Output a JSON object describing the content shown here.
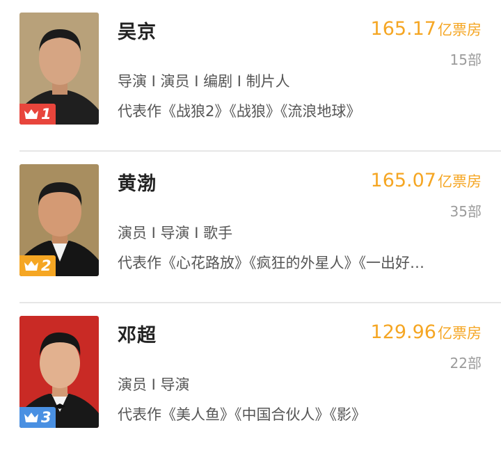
{
  "ranking": [
    {
      "rank": "1",
      "name": "吴京",
      "box_office": "165.17",
      "box_office_unit": "亿票房",
      "films_count": "15部",
      "roles": "导演 I 演员 I 编剧 I 制片人",
      "works": "代表作《战狼2》《战狼》《流浪地球》",
      "badge_color": "#e8453c",
      "badge_icon": "crown-icon",
      "photo_bg": "#b8a17a",
      "shirt_color": "#1f1f1f"
    },
    {
      "rank": "2",
      "name": "黄渤",
      "box_office": "165.07",
      "box_office_unit": "亿票房",
      "films_count": "35部",
      "roles": "演员 I 导演 I 歌手",
      "works": "代表作《心花路放》《疯狂的外星人》《一出好…",
      "badge_color": "#f5a623",
      "badge_icon": "crown-icon",
      "photo_bg": "#a88e60",
      "shirt_color": "#151515"
    },
    {
      "rank": "3",
      "name": "邓超",
      "box_office": "129.96",
      "box_office_unit": "亿票房",
      "films_count": "22部",
      "roles": "演员 I 导演",
      "works": "代表作《美人鱼》《中国合伙人》《影》",
      "badge_color": "#4a90e2",
      "badge_icon": "crown-icon",
      "photo_bg": "#c92a25",
      "shirt_color": "#181818"
    }
  ]
}
